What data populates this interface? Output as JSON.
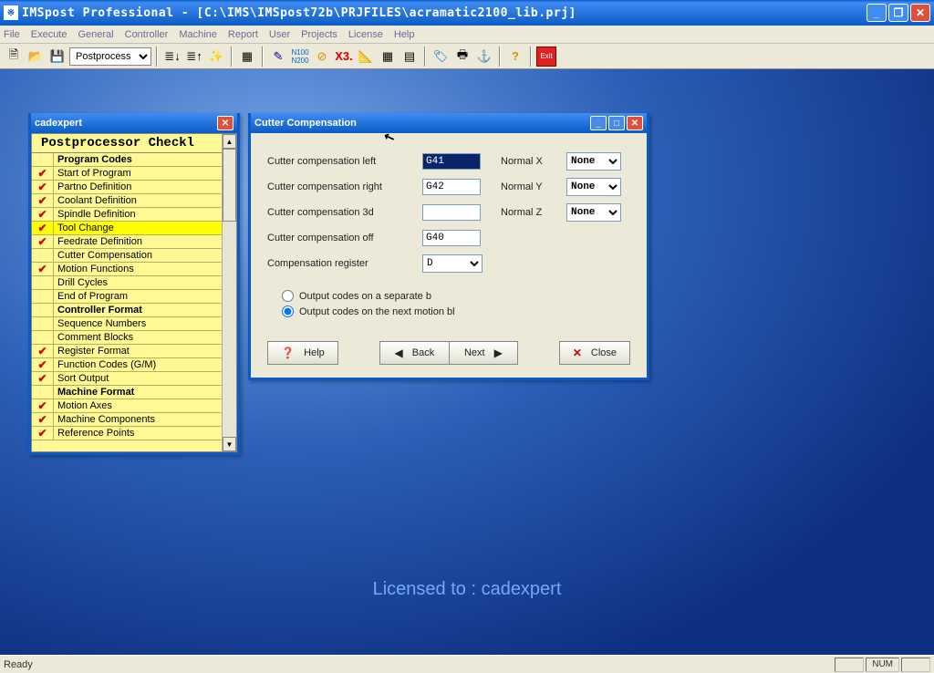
{
  "app": {
    "title": "IMSpost Professional - [C:\\IMS\\IMSpost72b\\PRJFILES\\acramatic2100_lib.prj]"
  },
  "menus": [
    "File",
    "Execute",
    "General",
    "Controller",
    "Machine",
    "Report",
    "User",
    "Projects",
    "License",
    "Help"
  ],
  "toolbar": {
    "dropdown_value": "Postprocess"
  },
  "watermark": "Licensed to : cadexpert",
  "status": {
    "ready": "Ready",
    "num": "NUM"
  },
  "cadexpert": {
    "title": "cadexpert",
    "header": "Postprocessor Checkl",
    "rows": [
      {
        "chk": "",
        "txt": "Program Codes",
        "header": true
      },
      {
        "chk": "✓",
        "txt": "Start of Program"
      },
      {
        "chk": "✓",
        "txt": "Partno Definition"
      },
      {
        "chk": "✓",
        "txt": "Coolant Definition"
      },
      {
        "chk": "✓",
        "txt": "Spindle Definition"
      },
      {
        "chk": "✓",
        "txt": "Tool Change",
        "selected": true
      },
      {
        "chk": "✓",
        "txt": "Feedrate Definition"
      },
      {
        "chk": "",
        "txt": "Cutter Compensation"
      },
      {
        "chk": "✓",
        "txt": "Motion Functions"
      },
      {
        "chk": "",
        "txt": "Drill Cycles"
      },
      {
        "chk": "",
        "txt": "End of Program"
      },
      {
        "chk": "",
        "txt": "Controller Format",
        "header": true
      },
      {
        "chk": "",
        "txt": "Sequence Numbers"
      },
      {
        "chk": "",
        "txt": "Comment Blocks"
      },
      {
        "chk": "✓",
        "txt": "Register Format"
      },
      {
        "chk": "✓",
        "txt": "Function Codes (G/M)"
      },
      {
        "chk": "✓",
        "txt": "Sort Output"
      },
      {
        "chk": "",
        "txt": "Machine Format",
        "header": true
      },
      {
        "chk": "✓",
        "txt": "Motion Axes"
      },
      {
        "chk": "✓",
        "txt": "Machine Components"
      },
      {
        "chk": "✓",
        "txt": "Reference Points"
      }
    ]
  },
  "cutter": {
    "title": "Cutter Compensation",
    "labels": {
      "left": "Cutter compensation left",
      "right": "Cutter compensation right",
      "three_d": "Cutter compensation 3d",
      "off": "Cutter compensation off",
      "register": "Compensation register",
      "nx": "Normal X",
      "ny": "Normal Y",
      "nz": "Normal Z"
    },
    "values": {
      "left": "G41",
      "right": "G42",
      "three_d": "",
      "off": "G40",
      "register": "D",
      "nx": "None",
      "ny": "None",
      "nz": "None"
    },
    "radios": {
      "separate": "Output codes on a separate b",
      "next_motion": "Output codes on the next motion bl",
      "selected": "next_motion"
    },
    "buttons": {
      "help": "Help",
      "back": "Back",
      "next": "Next",
      "close": "Close"
    }
  }
}
